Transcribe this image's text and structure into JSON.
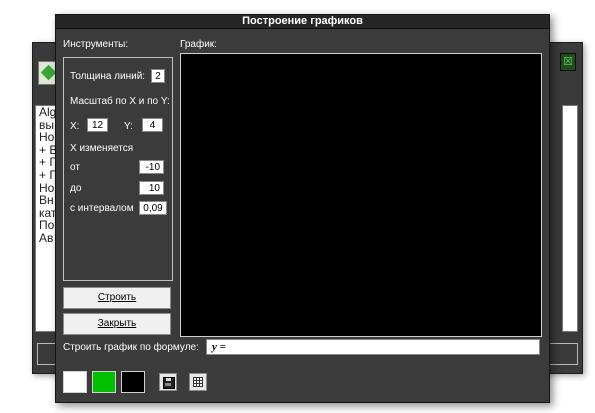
{
  "background_window": {
    "text_lines": [
      "Alg",
      "вы",
      "Но",
      "+ В",
      "+ Г",
      "+ Г",
      "Но",
      "Вн",
      "кат",
      "По",
      "Ав"
    ],
    "right_icon_glyph": "☒"
  },
  "dialog": {
    "title": "Построение графиков",
    "tools_label": "Инструменты:",
    "graph_label": "График:",
    "line_thickness": {
      "label": "Толщина линий:",
      "value": "2"
    },
    "scale_label": "Масштаб по X и по Y:",
    "scale_x": {
      "label": "X:",
      "value": "12"
    },
    "scale_y": {
      "label": "Y:",
      "value": "4"
    },
    "x_changes_label": "X изменяется",
    "x_from": {
      "label": "от",
      "value": "-10"
    },
    "x_to": {
      "label": "до",
      "value": "10"
    },
    "x_step": {
      "label": "с интервалом",
      "value": "0,09"
    },
    "build_button": "Строить",
    "close_button": "Закрыть",
    "formula_label": "Строить график по формуле:",
    "formula_prefix": "y ="
  },
  "colors": {
    "swatch_1": "#ffffff",
    "swatch_2": "#00c000",
    "swatch_3": "#000000",
    "graph_background": "#000000"
  },
  "icons": [
    "save-icon",
    "table-icon"
  ]
}
